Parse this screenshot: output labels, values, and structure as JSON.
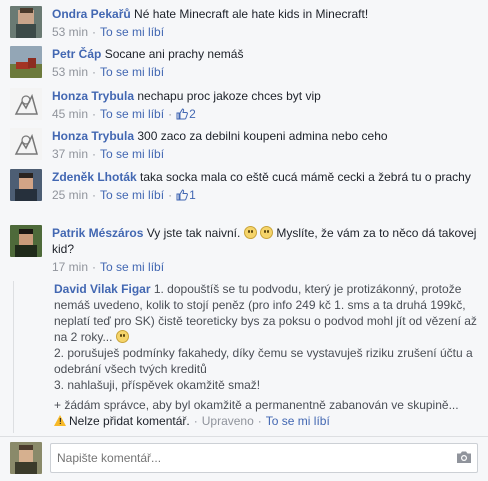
{
  "comments": [
    {
      "author": "Ondra Pekařů",
      "text": "Né hate Minecraft ale hate kids in Minecraft!",
      "time": "53 min",
      "like_label": "To se mi líbí"
    },
    {
      "author": "Petr Čáp",
      "text": "Socane ani prachy nemáš",
      "time": "53 min",
      "like_label": "To se mi líbí"
    },
    {
      "author": "Honza Trybula",
      "text": "nechapu proc jakoze chces byt vip",
      "time": "45 min",
      "like_label": "To se mi líbí",
      "likes": "2"
    },
    {
      "author": "Honza Trybula",
      "text": "300 zaco za debilni koupeni admina nebo ceho",
      "time": "37 min",
      "like_label": "To se mi líbí"
    },
    {
      "author": "Zdeněk Lhoták",
      "text": "taka socka mala co eště cucá mámě cecki a žebrá tu o prachy",
      "time": "25 min",
      "like_label": "To se mi líbí",
      "likes": "1"
    },
    {
      "author": "Patrik Mészáros",
      "text_before": "Vy jste tak naivní.",
      "text_after": "Myslíte, že vám za to něco dá takovej kid?",
      "time": "17 min",
      "like_label": "To se mi líbí"
    }
  ],
  "reply": {
    "author": "David Vilak Figar",
    "line1": "1. dopouštíš se tu podvodu, který je protizákonný, protože nemáš uvedeno, kolik to stojí peněz (pro info 249 kč 1. sms a ta druhá 199kč, neplatí teď pro SK) čistě teoreticky bys za poksu o podvod mohl jít od vězení až na 2 roky...",
    "line2": "2. porušuješ podmínky fakahedy, díky čemu se vystavuješ riziku zrušení účtu a odebrání všech tvých kreditů",
    "line3": "3. nahlašuji, příspěvek okamžitě smaž!",
    "note": "+ žádám správce, aby byl okamžitě a permanentně zabanován ve skupině...",
    "warning": "Nelze přidat komentář.",
    "edited": "Upraveno",
    "like_label": "To se mi líbí"
  },
  "compose": {
    "placeholder": "Napište komentář..."
  },
  "colors": {
    "link": "#4267b2",
    "meta": "#90949c",
    "background": "#f6f7f9"
  }
}
